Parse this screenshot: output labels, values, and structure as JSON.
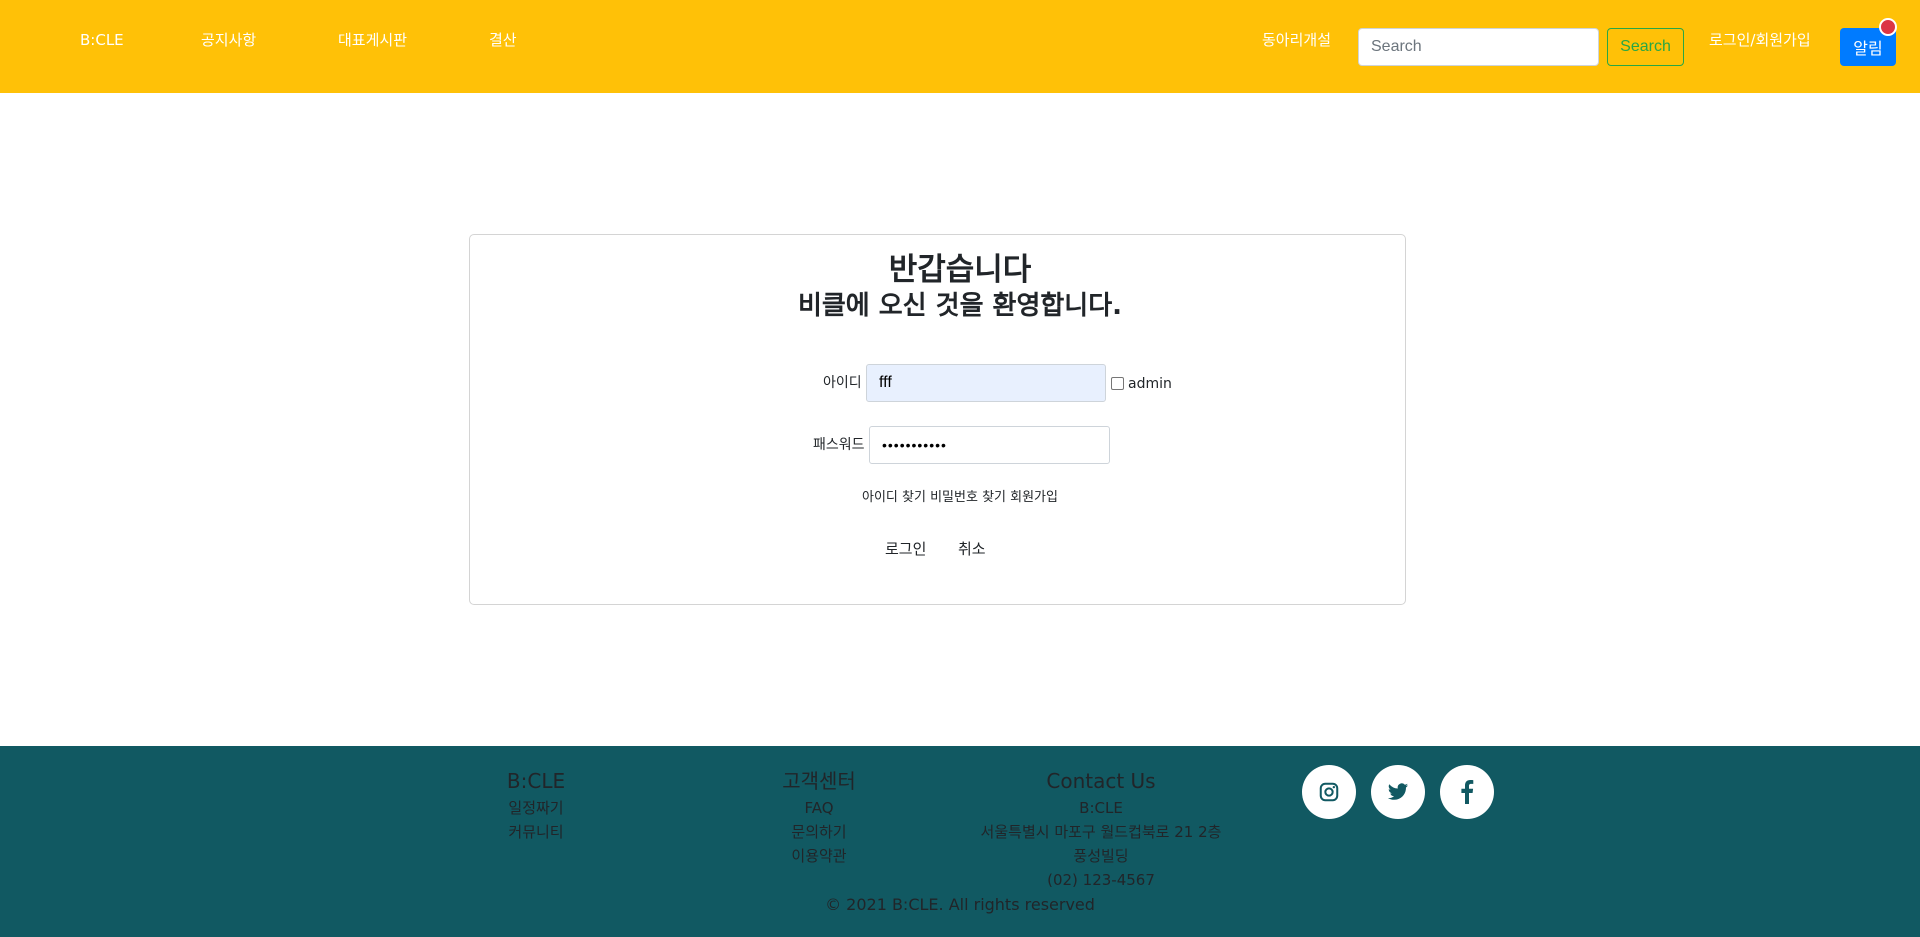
{
  "nav": {
    "brand": "B:CLE",
    "items": [
      "공지사항",
      "대표게시판",
      "결산"
    ],
    "club_create": "동아리개설",
    "search_placeholder": "Search",
    "search_button": "Search",
    "login_signup": "로그인/회원가입",
    "alert_button": "알림"
  },
  "login": {
    "title_line1": "반갑습니다",
    "title_line2": "비클에 오신 것을 환영합니다.",
    "id_label": "아이디",
    "id_value": "fff",
    "admin_label": "admin",
    "admin_checked": false,
    "password_label": "패스워드",
    "password_value": "•••••••••••",
    "links": [
      "아이디 찾기",
      "비밀번호 찾기",
      "회원가입"
    ],
    "login_button": "로그인",
    "cancel_button": "취소"
  },
  "footer": {
    "col1": {
      "title": "B:CLE",
      "items": [
        "일정짜기",
        "커뮤니티"
      ]
    },
    "col2": {
      "title": "고객센터",
      "items": [
        "FAQ",
        "문의하기",
        "이용약관"
      ]
    },
    "col3": {
      "title": "Contact Us",
      "items": [
        "B:CLE",
        "서울특별시 마포구 월드컵북로 21 2층",
        "풍성빌딩",
        "(02) 123-4567"
      ]
    },
    "social": [
      "instagram-icon",
      "twitter-icon",
      "facebook-icon"
    ],
    "copyright": "© 2021 B:CLE. All rights reserved"
  },
  "colors": {
    "navbar": "#ffc107",
    "footer": "#115962",
    "search_button": "#28a745",
    "alert_button": "#007bff",
    "alert_dot": "#dc3545",
    "id_input_autofill": "#e8f0fe"
  }
}
